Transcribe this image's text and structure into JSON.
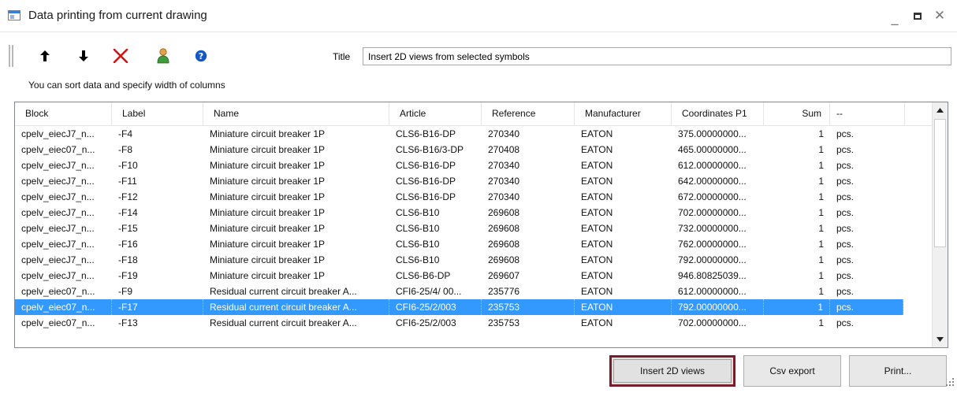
{
  "window": {
    "title": "Data printing from current drawing",
    "controls": [
      "minimize",
      "maximize",
      "close"
    ]
  },
  "toolbar": {
    "buttons": [
      {
        "name": "move-up",
        "icon": "arrow-up-icon"
      },
      {
        "name": "move-down",
        "icon": "arrow-down-icon"
      },
      {
        "name": "delete",
        "icon": "red-x-icon"
      },
      {
        "name": "user",
        "icon": "user-icon"
      },
      {
        "name": "help",
        "icon": "help-icon"
      }
    ],
    "title_label": "Title",
    "title_value": "Insert 2D views from selected symbols"
  },
  "hint": "You can sort data and specify width of columns",
  "table": {
    "columns": [
      "Block",
      "Label",
      "Name",
      "Article",
      "Reference",
      "Manufacturer",
      "Coordinates P1",
      "Sum",
      "--"
    ],
    "rows": [
      [
        "cpelv_eiecJ7_n...",
        "-F4",
        "Miniature circuit breaker 1P",
        "CLS6-B16-DP",
        "270340",
        "EATON",
        "375.00000000...",
        "1",
        "pcs."
      ],
      [
        "cpelv_eiec07_n...",
        "-F8",
        "Miniature circuit breaker 1P",
        "CLS6-B16/3-DP",
        "270408",
        "EATON",
        "465.00000000...",
        "1",
        "pcs."
      ],
      [
        "cpelv_eiecJ7_n...",
        "-F10",
        "Miniature circuit breaker 1P",
        "CLS6-B16-DP",
        "270340",
        "EATON",
        "612.00000000...",
        "1",
        "pcs."
      ],
      [
        "cpelv_eiecJ7_n...",
        "-F11",
        "Miniature circuit breaker 1P",
        "CLS6-B16-DP",
        "270340",
        "EATON",
        "642.00000000...",
        "1",
        "pcs."
      ],
      [
        "cpelv_eiecJ7_n...",
        "-F12",
        "Miniature circuit breaker 1P",
        "CLS6-B16-DP",
        "270340",
        "EATON",
        "672.00000000...",
        "1",
        "pcs."
      ],
      [
        "cpelv_eiecJ7_n...",
        "-F14",
        "Miniature circuit breaker 1P",
        "CLS6-B10",
        "269608",
        "EATON",
        "702.00000000...",
        "1",
        "pcs."
      ],
      [
        "cpelv_eiecJ7_n...",
        "-F15",
        "Miniature circuit breaker 1P",
        "CLS6-B10",
        "269608",
        "EATON",
        "732.00000000...",
        "1",
        "pcs."
      ],
      [
        "cpelv_eiecJ7_n...",
        "-F16",
        "Miniature circuit breaker 1P",
        "CLS6-B10",
        "269608",
        "EATON",
        "762.00000000...",
        "1",
        "pcs."
      ],
      [
        "cpelv_eiecJ7_n...",
        "-F18",
        "Miniature circuit breaker 1P",
        "CLS6-B10",
        "269608",
        "EATON",
        "792.00000000...",
        "1",
        "pcs."
      ],
      [
        "cpelv_eiecJ7_n...",
        "-F19",
        "Miniature circuit breaker 1P",
        "CLS6-B6-DP",
        "269607",
        "EATON",
        "946.80825039...",
        "1",
        "pcs."
      ],
      [
        "cpelv_eiec07_n...",
        "-F9",
        "Residual current circuit breaker A...",
        "CFI6-25/4/ 00...",
        "235776",
        "EATON",
        "612.00000000...",
        "1",
        "pcs."
      ],
      [
        "cpelv_eiec07_n...",
        "-F17",
        "Residual current circuit breaker A...",
        "CFI6-25/2/003",
        "235753",
        "EATON",
        "792.00000000...",
        "1",
        "pcs."
      ],
      [
        "cpelv_eiec07_n...",
        "-F13",
        "Residual current circuit breaker A...",
        "CFI6-25/2/003",
        "235753",
        "EATON",
        "702.00000000...",
        "1",
        "pcs."
      ]
    ],
    "selected_row_label": "-F17"
  },
  "buttons": {
    "insert": "Insert 2D views",
    "csv": "Csv export",
    "print": "Print..."
  },
  "colors": {
    "selection": "#3399ff",
    "focus_border": "#7a1d2b"
  }
}
